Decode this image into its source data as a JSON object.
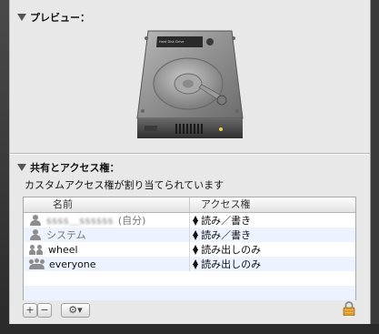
{
  "preview_header": "プレビュー：",
  "sharing_header": "共有とアクセス権：",
  "description": "カスタムアクセス権が割り当てられています",
  "hdd_label": "Hard Disk Drive",
  "table": {
    "col_name": "名前",
    "col_access": "アクセス権",
    "rows": [
      {
        "name": "ssss＿ssssss",
        "suffix": "(自分)",
        "access": "読み／書き",
        "icon": "user-icon"
      },
      {
        "name": "システム",
        "suffix": "",
        "access": "読み／書き",
        "icon": "user-icon"
      },
      {
        "name": "wheel",
        "suffix": "",
        "access": "読み出しのみ",
        "icon": "group-icon"
      },
      {
        "name": "everyone",
        "suffix": "",
        "access": "読み出しのみ",
        "icon": "everyone-icon"
      }
    ]
  },
  "buttons": {
    "add": "+",
    "remove": "−",
    "gear": "⚙▾"
  },
  "colors": {
    "panel": "#e8e8e8",
    "row_alt": "#edf3fe",
    "lock": "#d99a2b"
  }
}
